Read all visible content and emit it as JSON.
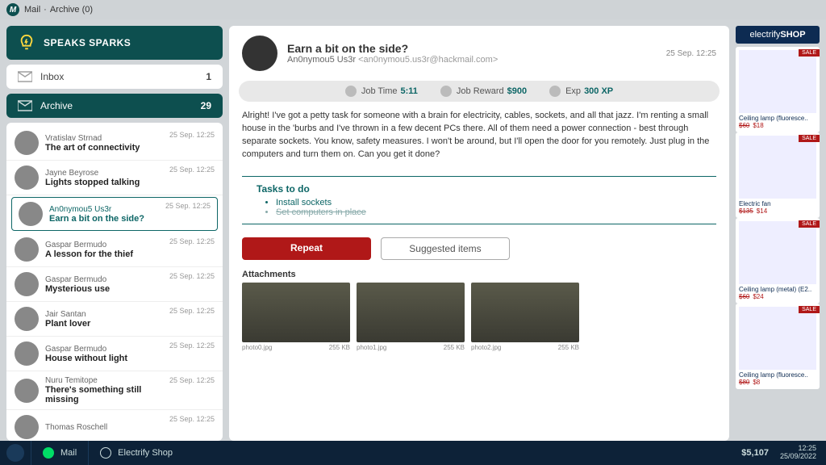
{
  "titlebar": {
    "app": "Mail",
    "crumb": "Archive (0)"
  },
  "speaks": {
    "label": "SPEAKS SPARKS"
  },
  "folders": {
    "inbox": {
      "label": "Inbox",
      "count": "1"
    },
    "archive": {
      "label": "Archive",
      "count": "29"
    }
  },
  "mails": [
    {
      "from": "Vratislav Strnad",
      "subj": "The art of connectivity",
      "time": "25 Sep. 12:25"
    },
    {
      "from": "Jayne Beyrose",
      "subj": "Lights stopped talking",
      "time": "25 Sep. 12:25"
    },
    {
      "from": "An0nymou5 Us3r",
      "subj": "Earn a bit on the side?",
      "time": "25 Sep. 12:25",
      "sel": true
    },
    {
      "from": "Gaspar Bermudo",
      "subj": "A lesson for the thief",
      "time": "25 Sep. 12:25"
    },
    {
      "from": "Gaspar Bermudo",
      "subj": "Mysterious use",
      "time": "25 Sep. 12:25"
    },
    {
      "from": "Jair Santan",
      "subj": "Plant lover",
      "time": "25 Sep. 12:25"
    },
    {
      "from": "Gaspar Bermudo",
      "subj": "House without light",
      "time": "25 Sep. 12:25"
    },
    {
      "from": "Nuru Temitope",
      "subj": "There's something still missing",
      "time": "25 Sep. 12:25"
    },
    {
      "from": "Thomas Roschell",
      "subj": "",
      "time": "25 Sep. 12:25"
    }
  ],
  "message": {
    "subject": "Earn a bit on the side?",
    "from_name": "An0nymou5 Us3r",
    "from_addr": "<an0nymou5.us3r@hackmail.com>",
    "time": "25 Sep. 12:25",
    "stats": {
      "jobtime_label": "Job Time",
      "jobtime_val": "5:11",
      "reward_label": "Job Reward",
      "reward_val": "$900",
      "exp_label": "Exp",
      "exp_val": "300 XP"
    },
    "body": "Alright! I've got a petty task for someone with a brain for electricity, cables, sockets, and all that jazz. I'm renting a small house in the 'burbs and I've thrown in a few decent PCs there. All of them need a power connection - best through separate sockets. You know, safety measures. I won't be around, but I'll open the door for you remotely. Just plug in the computers and turn them on. Can you get it done?",
    "tasks_title": "Tasks to do",
    "tasks": [
      {
        "text": "Install sockets",
        "done": false
      },
      {
        "text": "Set computers in place",
        "done": true
      }
    ],
    "repeat_label": "Repeat",
    "suggested_label": "Suggested items",
    "attach_title": "Attachments",
    "attachments": [
      {
        "name": "photo0.jpg",
        "size": "255 KB"
      },
      {
        "name": "photo1.jpg",
        "size": "255 KB"
      },
      {
        "name": "photo2.jpg",
        "size": "255 KB"
      }
    ]
  },
  "shop": {
    "logo_a": "electrify",
    "logo_b": "SHOP",
    "items": [
      {
        "name": "Ceiling lamp (fluoresce..",
        "old": "$60",
        "new": "$18",
        "tag": "SALE"
      },
      {
        "name": "Electric fan",
        "old": "$135",
        "new": "$14",
        "tag": "SALE"
      },
      {
        "name": "Ceiling lamp (metal) (E2..",
        "old": "$60",
        "new": "$24",
        "tag": "SALE"
      },
      {
        "name": "Ceiling lamp (fluoresce..",
        "old": "$80",
        "new": "$8",
        "tag": "SALE"
      }
    ]
  },
  "taskbar": {
    "mail": "Mail",
    "shop": "Electrify Shop",
    "money": "$5,107",
    "clock": "12:25",
    "date": "25/09/2022"
  }
}
